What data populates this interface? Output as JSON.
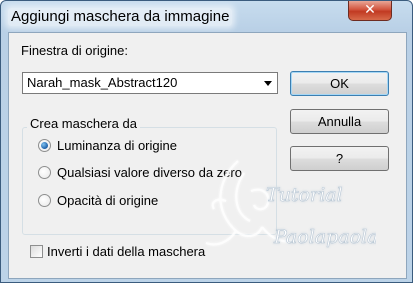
{
  "window": {
    "title": "Aggiungi maschera da immagine",
    "close_glyph": "✕"
  },
  "source": {
    "label": "Finestra di origine:",
    "selected": "Narah_mask_Abstract120"
  },
  "buttons": {
    "ok": "OK",
    "cancel": "Annulla",
    "help": "?"
  },
  "mask_group": {
    "title": "Crea maschera da",
    "options": [
      {
        "label": "Luminanza di origine",
        "checked": true
      },
      {
        "label": "Qualsiasi valore diverso da zero",
        "checked": false
      },
      {
        "label": "Opacità di origine",
        "checked": false
      }
    ]
  },
  "invert": {
    "label": "Inverti i dati della maschera",
    "checked": false
  },
  "watermark": {
    "line1": "Tutorial",
    "line2": "Paolapaola"
  }
}
